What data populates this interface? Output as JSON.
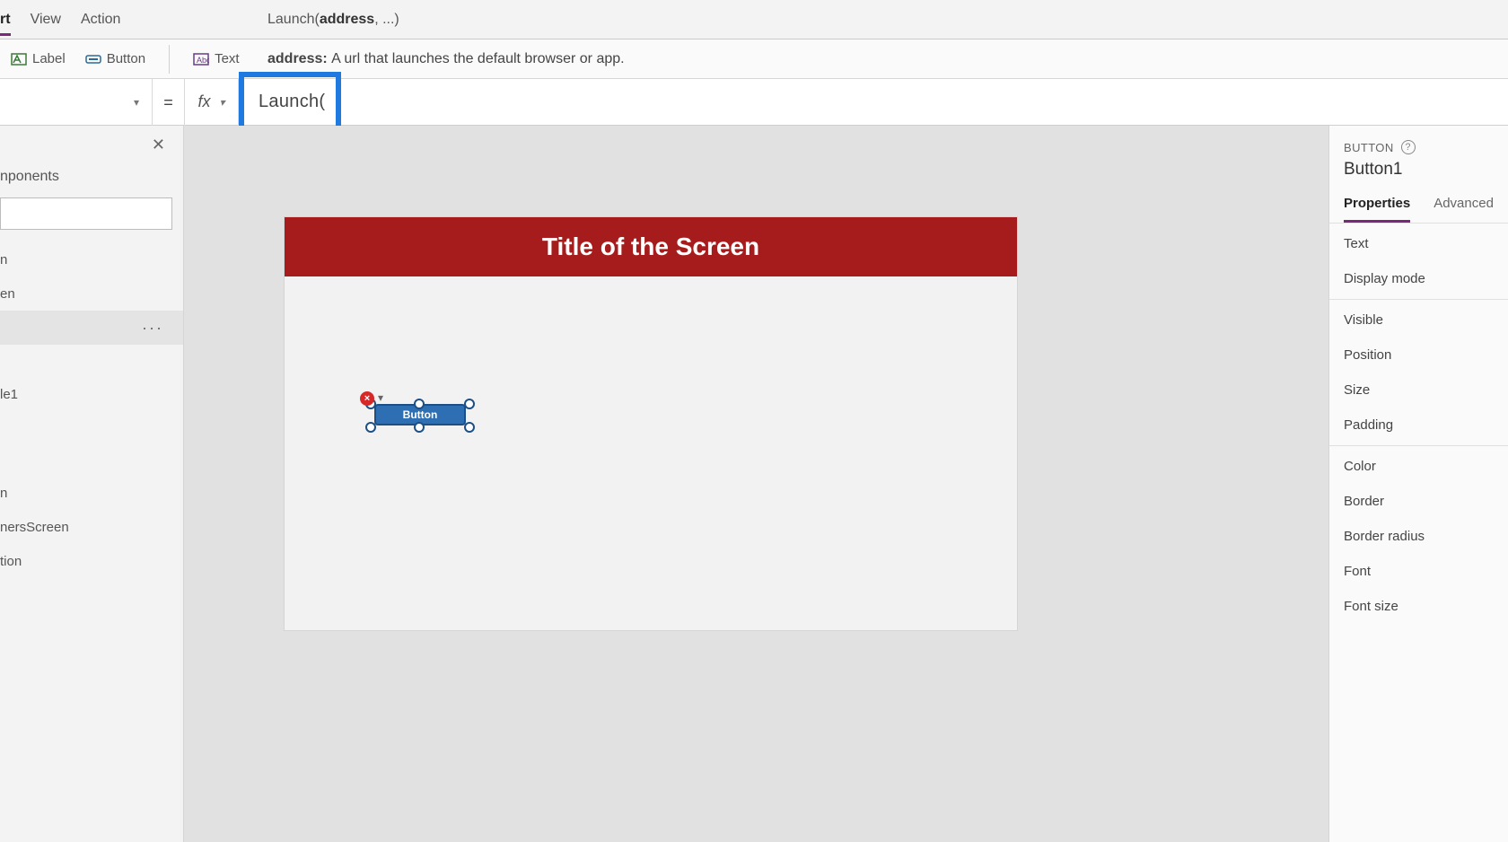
{
  "menu": {
    "tabs": [
      "rt",
      "View",
      "Action"
    ],
    "active_index": 0,
    "signature_prefix": "Launch(",
    "signature_bold": "address",
    "signature_suffix": ", ...)"
  },
  "ribbon": {
    "items": [
      {
        "icon": "label-icon",
        "label": "Label"
      },
      {
        "icon": "button-icon",
        "label": "Button"
      },
      {
        "icon": "text-icon",
        "label": "Text"
      }
    ],
    "param_name": "address:",
    "param_desc": "A url that launches the default browser or app."
  },
  "formula": {
    "property": "",
    "equals": "=",
    "fx": "fx",
    "text": "Launch("
  },
  "tree": {
    "tab_label": "nponents",
    "items": [
      {
        "label": "n",
        "selected": false
      },
      {
        "label": "en",
        "selected": false
      },
      {
        "label": "",
        "selected": true
      },
      {
        "label": "le1",
        "selected": false
      },
      {
        "label": "n",
        "selected": false
      },
      {
        "label": "nersScreen",
        "selected": false
      },
      {
        "label": "tion",
        "selected": false
      }
    ]
  },
  "canvas": {
    "header_title": "Title of the Screen",
    "button_text": "Button",
    "error_glyph": "×",
    "colors": {
      "header_bg": "#a61c1c",
      "button_bg": "#2e6fb3"
    }
  },
  "properties": {
    "type_label": "BUTTON",
    "control_name": "Button1",
    "tabs": [
      "Properties",
      "Advanced"
    ],
    "active_tab": 0,
    "groups": [
      [
        "Text",
        "Display mode"
      ],
      [
        "Visible",
        "Position",
        "Size",
        "Padding"
      ],
      [
        "Color",
        "Border",
        "Border radius",
        "Font",
        "Font size"
      ]
    ]
  }
}
